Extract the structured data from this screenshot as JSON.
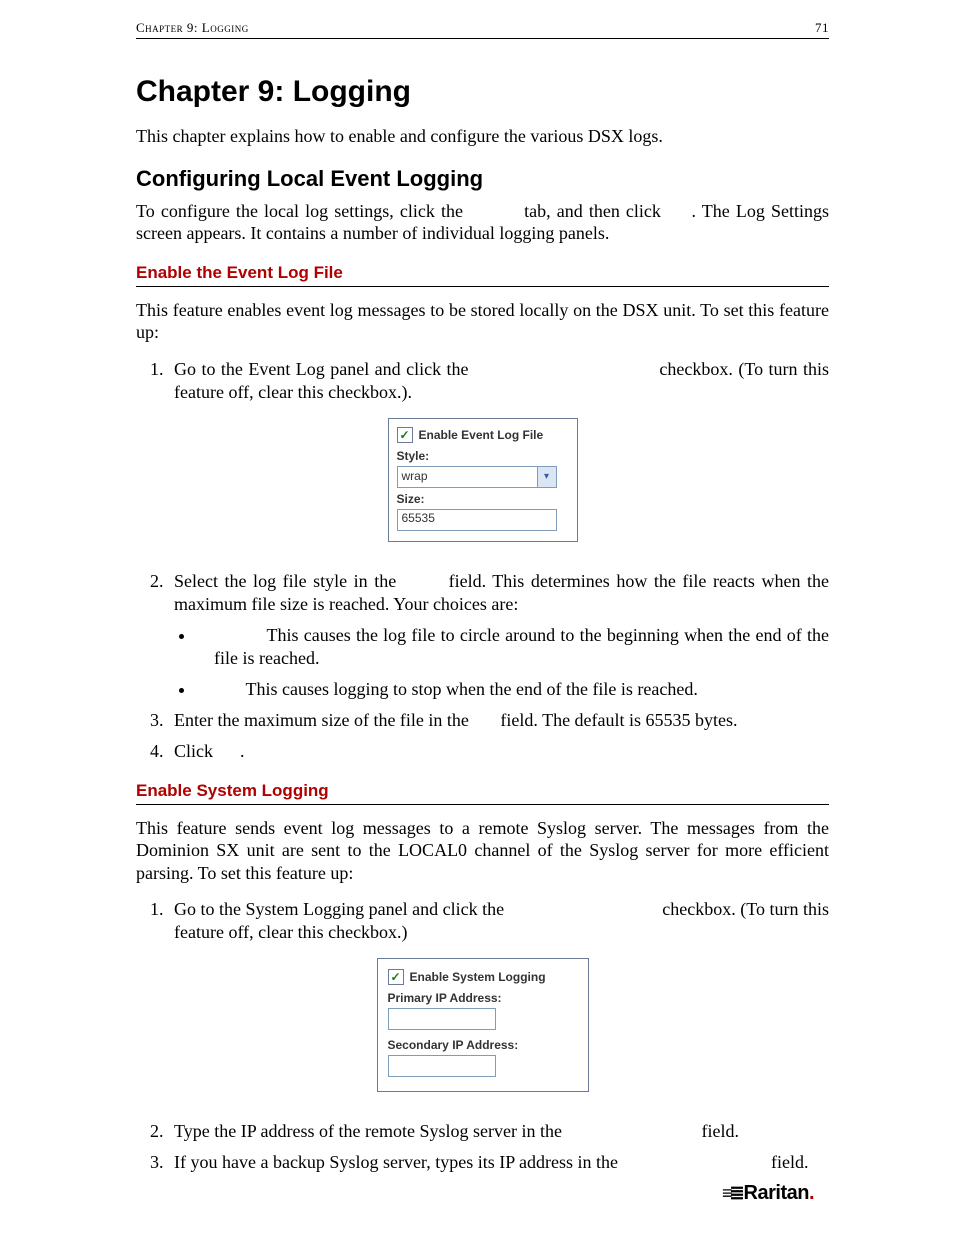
{
  "header": {
    "left": "Chapter 9: Logging",
    "right": "71"
  },
  "chapter_title": "Chapter 9: Logging",
  "intro": "This chapter explains how to enable and configure the various DSX logs.",
  "section1": {
    "title": "Configuring Local Event Logging",
    "para": "To configure the local log settings, click the          tab, and then click     . The Log Settings screen appears. It contains a number of individual logging panels."
  },
  "sub1": {
    "title": "Enable the Event Log File",
    "para": "This feature enables event log messages to be stored locally on the DSX unit. To set this feature up:",
    "step1": "Go to the Event Log panel and click the                                   checkbox. (To turn this feature off, clear this checkbox.).",
    "panel": {
      "checkbox_label": "Enable Event Log File",
      "style_label": "Style:",
      "style_value": "wrap",
      "size_label": "Size:",
      "size_value": "65535"
    },
    "step2": "Select the log file style in the        field. This determines how the file reacts when the maximum file size is reached. Your choices are:",
    "bullet1": "          This causes the log file to circle around to the beginning when the end of the file is reached.",
    "bullet2": "       This causes logging to stop when the end of the file is reached.",
    "step3": "Enter the maximum size of the file in the       field. The default is 65535 bytes.",
    "step4": "Click      ."
  },
  "sub2": {
    "title": "Enable System Logging",
    "para": "This feature sends event log messages to a remote Syslog server. The messages from the Dominion SX unit are sent to the LOCAL0 channel of the Syslog server for more efficient parsing. To set this feature up:",
    "step1": "Go to the System Logging panel and click the                                   checkbox. (To turn this feature off, clear this checkbox.)",
    "panel": {
      "checkbox_label": "Enable System Logging",
      "primary_label": "Primary IP Address:",
      "secondary_label": "Secondary IP Address:"
    },
    "step2": "Type the IP address of the remote Syslog server in the                               field.",
    "step3": "If you have a backup Syslog server, types its IP address in the                                  field."
  },
  "footer_brand": "Raritan"
}
